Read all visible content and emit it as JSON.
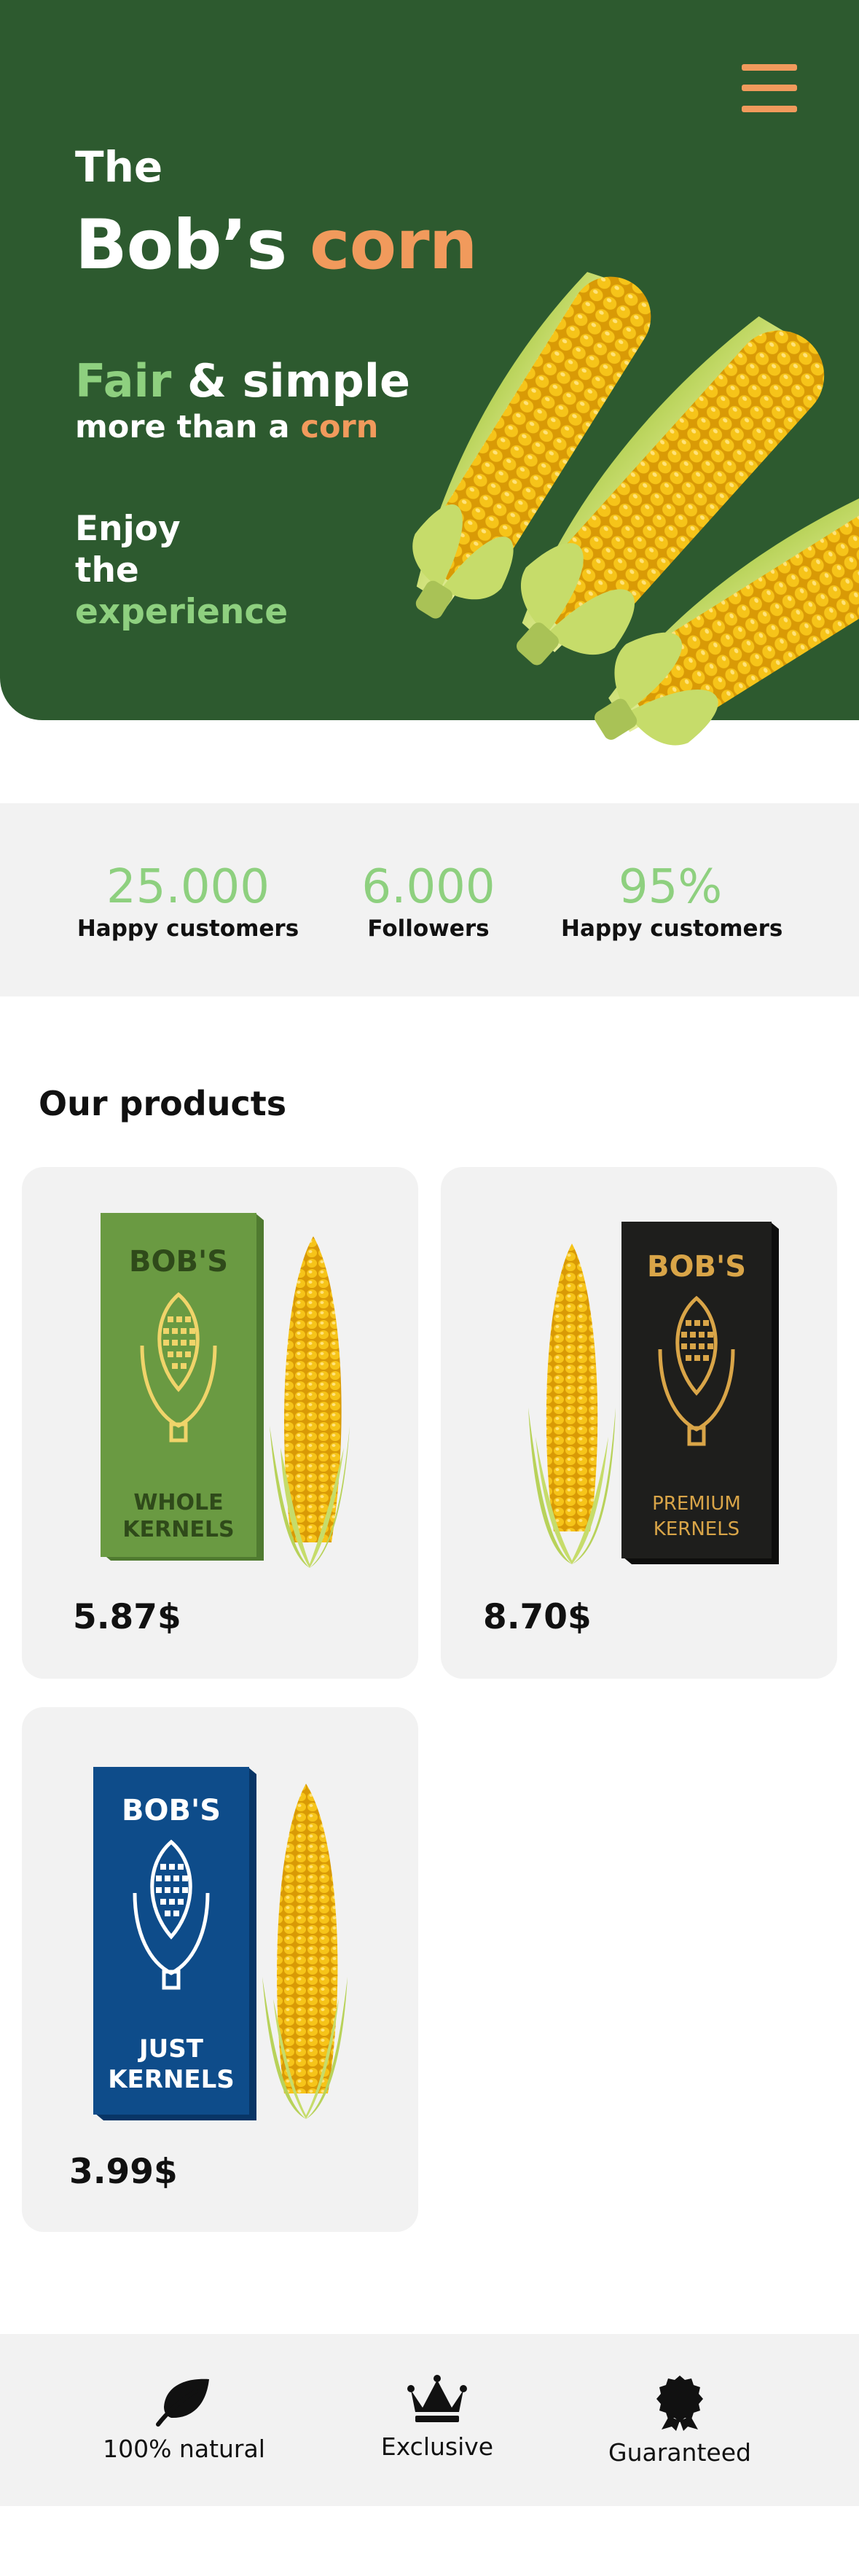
{
  "hero": {
    "the": "The",
    "brand_main": "Bob’s",
    "brand_accent": "corn",
    "tagline_accent": "Fair",
    "tagline_rest": "& simple",
    "subline_main": "more than a",
    "subline_accent": "corn",
    "enjoy_1": "Enjoy",
    "enjoy_2": "the",
    "enjoy_3": "experience",
    "menu_icon": "hamburger-menu-icon"
  },
  "stats": [
    {
      "value": "25.000",
      "label": "Happy customers"
    },
    {
      "value": "6.000",
      "label": "Followers"
    },
    {
      "value": "95%",
      "label": "Happy customers"
    }
  ],
  "products": {
    "title": "Our products",
    "items": [
      {
        "brand": "BOB'S",
        "line1": "WHOLE",
        "line2": "KERNELS",
        "price": "5.87$",
        "box_color": "#6a9a42"
      },
      {
        "brand": "BOB'S",
        "line1": "PREMIUM",
        "line2": "KERNELS",
        "price": "8.70$",
        "box_color": "#1e1e1c"
      },
      {
        "brand": "BOB'S",
        "line1": "JUST",
        "line2": "KERNELS",
        "price": "3.99$",
        "box_color": "#0e4c8a"
      }
    ]
  },
  "features": [
    {
      "label": "100% natural",
      "icon": "leaf-icon"
    },
    {
      "label": "Exclusive",
      "icon": "crown-icon"
    },
    {
      "label": "Guaranteed",
      "icon": "award-badge-icon"
    }
  ],
  "colors": {
    "hero_bg": "#2d5a2f",
    "accent_orange": "#f19a5c",
    "accent_green": "#8ed07f",
    "panel_bg": "#f2f2f2"
  }
}
